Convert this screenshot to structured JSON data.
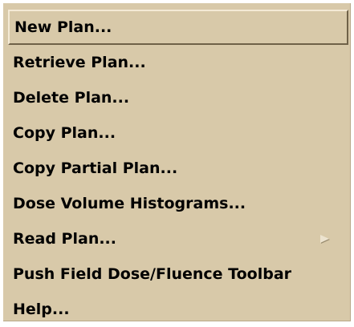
{
  "menu": {
    "items": [
      {
        "label": "New Plan...",
        "highlighted": true
      },
      {
        "label": "Retrieve Plan..."
      },
      {
        "label": "Delete Plan..."
      },
      {
        "label": "Copy Plan..."
      },
      {
        "label": "Copy Partial Plan..."
      },
      {
        "label": "Dose Volume Histograms..."
      },
      {
        "label": "Read Plan...",
        "submenu_icon": "submenu-arrow-icon"
      },
      {
        "label": "Push Field Dose/Fluence Toolbar"
      },
      {
        "label": "Help..."
      }
    ]
  },
  "colors": {
    "menu_background": "#d8c9a9",
    "text": "#000000"
  }
}
